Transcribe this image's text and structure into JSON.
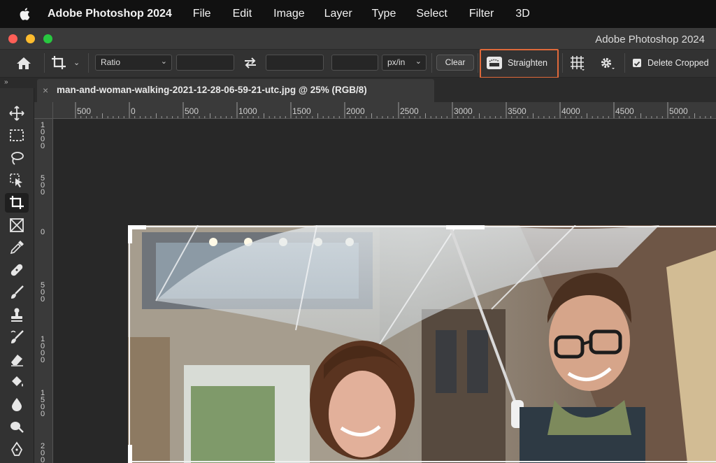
{
  "menubar": {
    "app_name": "Adobe Photoshop 2024",
    "items": [
      "File",
      "Edit",
      "Image",
      "Layer",
      "Type",
      "Select",
      "Filter",
      "3D"
    ]
  },
  "window": {
    "title": "Adobe Photoshop 2024",
    "traffic_lights": [
      "#ff5f57",
      "#febc2e",
      "#28c840"
    ]
  },
  "options_bar": {
    "ratio_select": "Ratio",
    "unit_select": "px/in",
    "clear_label": "Clear",
    "straighten_label": "Straighten",
    "delete_cropped_label": "Delete Cropped",
    "delete_cropped_checked": true,
    "highlight_color": "#e0693a"
  },
  "document": {
    "tab_title": "man-and-woman-walking-2021-12-28-06-59-21-utc.jpg @ 25% (RGB/8)",
    "close_glyph": "×"
  },
  "rulers": {
    "horizontal": [
      "500",
      "0",
      "500",
      "1000",
      "1500",
      "2000",
      "2500",
      "3000",
      "3500",
      "4000",
      "4500",
      "5000"
    ],
    "vertical": [
      "1000",
      "500",
      "0",
      "500",
      "1000",
      "1500",
      "200"
    ]
  },
  "tools": [
    {
      "name": "move-tool",
      "icon": "move-icon"
    },
    {
      "name": "marquee-tool",
      "icon": "marquee-icon"
    },
    {
      "name": "lasso-tool",
      "icon": "lasso-icon"
    },
    {
      "name": "object-selection-tool",
      "icon": "object-selection-icon"
    },
    {
      "name": "crop-tool",
      "icon": "crop-icon",
      "active": true
    },
    {
      "name": "frame-tool",
      "icon": "frame-icon"
    },
    {
      "name": "eyedropper-tool",
      "icon": "eyedropper-icon"
    },
    {
      "name": "healing-tool",
      "icon": "bandage-icon"
    },
    {
      "name": "brush-tool",
      "icon": "brush-icon"
    },
    {
      "name": "stamp-tool",
      "icon": "stamp-icon"
    },
    {
      "name": "history-brush-tool",
      "icon": "history-brush-icon"
    },
    {
      "name": "eraser-tool",
      "icon": "eraser-icon"
    },
    {
      "name": "paint-bucket-tool",
      "icon": "paint-bucket-icon"
    },
    {
      "name": "blur-tool",
      "icon": "drop-icon"
    },
    {
      "name": "dodge-tool",
      "icon": "dodge-icon"
    },
    {
      "name": "pen-tool",
      "icon": "pen-icon"
    }
  ]
}
